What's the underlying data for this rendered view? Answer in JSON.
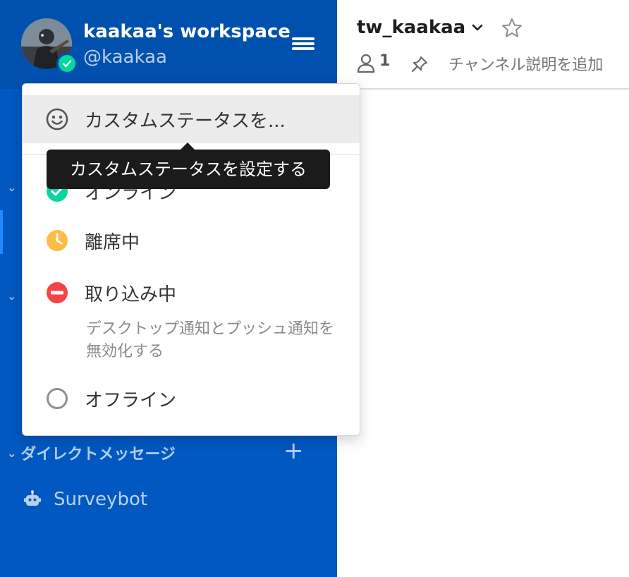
{
  "sidebar": {
    "workspace_name": "kaakaa's workspace",
    "username": "@kaakaa",
    "direct_messages_label": "ダイレクトメッセージ",
    "direct_messages": [
      {
        "label": "Surveybot"
      }
    ]
  },
  "channel": {
    "name": "tw_kaakaa",
    "member_count": "1",
    "description_placeholder": "チャンネル説明を追加"
  },
  "status_menu": {
    "custom_status_label": "カスタムステータスを...",
    "tooltip": "カスタムステータスを設定する",
    "items": [
      {
        "label": "オンライン",
        "icon": "online-check-icon",
        "color": "#06d6a0"
      },
      {
        "label": "離席中",
        "icon": "away-clock-icon",
        "color": "#ffbc42"
      },
      {
        "label": "取り込み中",
        "icon": "dnd-minus-icon",
        "color": "#f74343"
      },
      {
        "label": "オフライン",
        "icon": "offline-circle-icon",
        "color": "#8f8f8f"
      }
    ],
    "dnd_description": "デスクトップ通知とプッシュ通知を無効化する"
  },
  "colors": {
    "sidebar_bg": "#0058c0",
    "sidebar_header_bg": "#0050ae",
    "online": "#06d6a0",
    "away": "#ffbc42",
    "dnd": "#f74343"
  }
}
